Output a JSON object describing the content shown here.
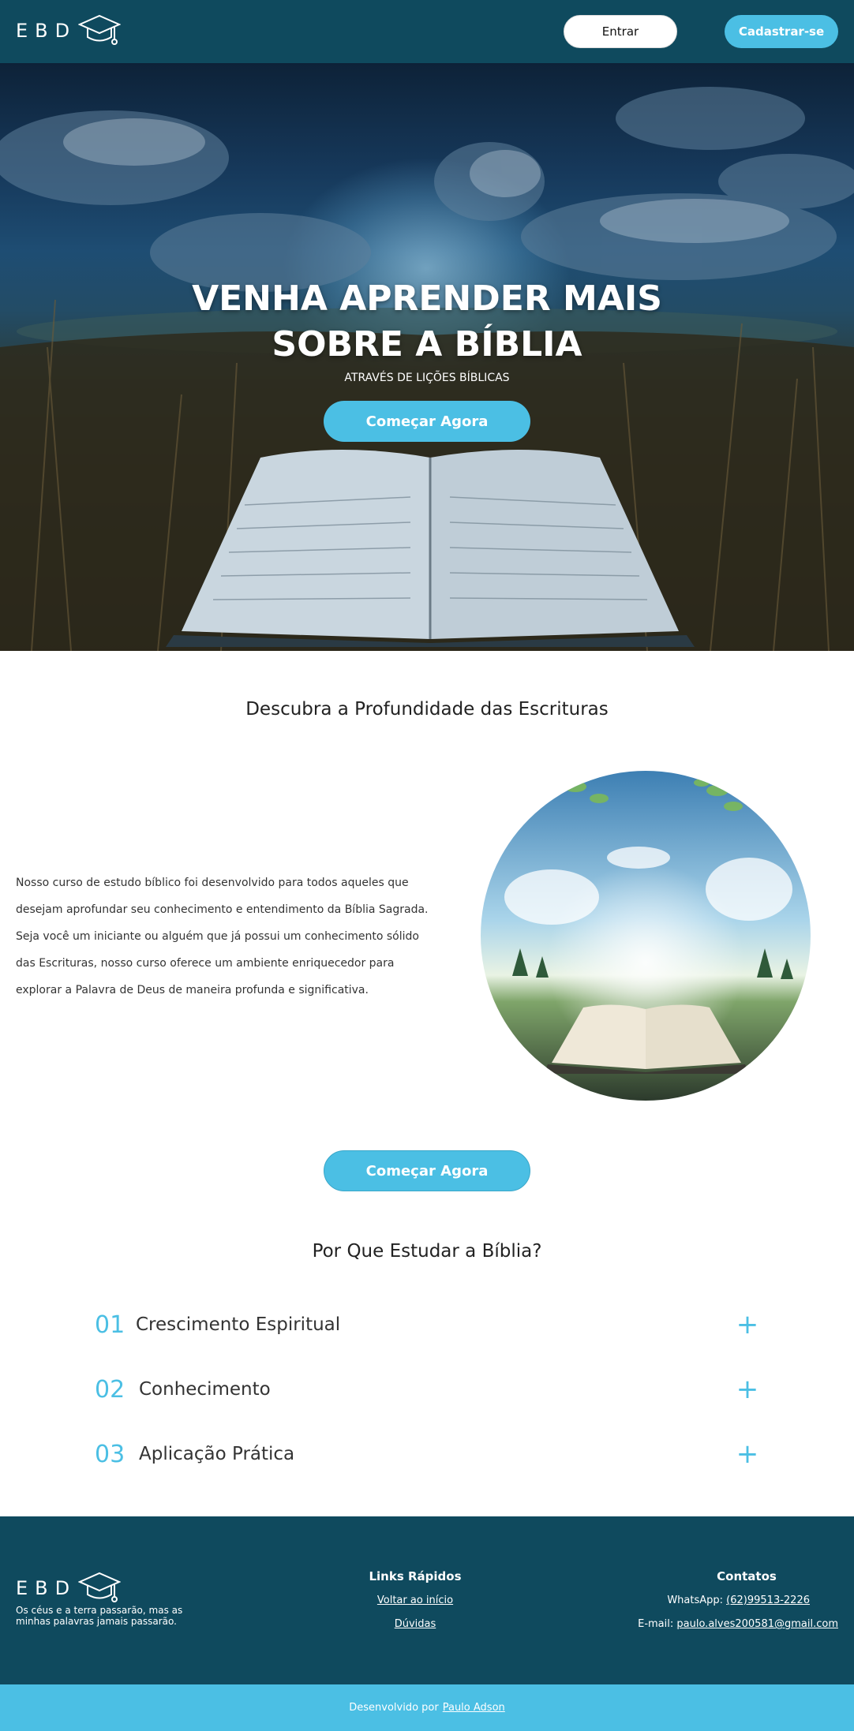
{
  "header": {
    "logo_text": "EBD",
    "login_label": "Entrar",
    "signup_label": "Cadastrar-se"
  },
  "hero": {
    "title_line1": "VENHA APRENDER MAIS",
    "title_line2": "SOBRE A BÍBLIA",
    "subtitle": "ATRAVÉS DE LIÇÕES BÍBLICAS",
    "cta_label": "Começar Agora"
  },
  "about": {
    "title": "Descubra a Profundidade das Escrituras",
    "text": "Nosso curso de estudo bíblico foi desenvolvido para todos aqueles que desejam aprofundar seu conhecimento e entendimento da Bíblia Sagrada. Seja você um iniciante ou alguém que já possui um conhecimento sólido das Escrituras, nosso curso oferece um ambiente enriquecedor para explorar a Palavra de Deus de maneira profunda e significativa.",
    "cta_label": "Começar Agora"
  },
  "why": {
    "title": "Por Que Estudar a Bíblia?",
    "items": [
      {
        "num": "01",
        "label": "Crescimento Espiritual",
        "icon": "plus-icon"
      },
      {
        "num": "02",
        "label": "Conhecimento",
        "icon": "plus-icon"
      },
      {
        "num": "03",
        "label": "Aplicação Prática",
        "icon": "plus-icon"
      }
    ]
  },
  "footer": {
    "logo_text": "EBD",
    "quote": "Os céus e a terra passarão, mas as minhas palavras jamais passarão.",
    "links_title": "Links Rápidos",
    "links": [
      "Voltar ao início",
      "Dúvidas"
    ],
    "contacts_title": "Contatos",
    "whatsapp_label": "WhatsApp:",
    "whatsapp_value": "(62)99513-2226",
    "email_label": "E-mail:",
    "email_value": "paulo.alves200581@gmail.com"
  },
  "bottom": {
    "credit_label": "Desenvolvido por",
    "credit_name": "Paulo Adson"
  },
  "colors": {
    "header_bg": "#0f4a5e",
    "accent": "#4bbfe4"
  }
}
